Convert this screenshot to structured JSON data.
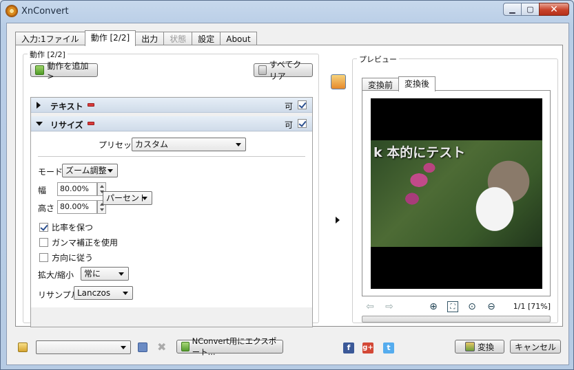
{
  "window": {
    "title": "XnConvert"
  },
  "tabs": [
    {
      "label": "入力:1ファイル",
      "state": "normal"
    },
    {
      "label": "動作 [2/2]",
      "state": "active"
    },
    {
      "label": "出力",
      "state": "normal"
    },
    {
      "label": "状態",
      "state": "disabled"
    },
    {
      "label": "設定",
      "state": "normal"
    },
    {
      "label": "About",
      "state": "normal"
    }
  ],
  "actions": {
    "group_title": "動作 [2/2]",
    "add_button": "動作を追加>",
    "clear_button": "すべてクリア",
    "operations": [
      {
        "label": "テキスト",
        "expanded": false,
        "ok_label": "可",
        "checked": true
      },
      {
        "label": "リサイズ",
        "expanded": true,
        "ok_label": "可",
        "checked": true
      }
    ],
    "resize": {
      "preset_label": "プリセット",
      "preset_value": "カスタム",
      "mode_label": "モード",
      "mode_value": "ズーム調整",
      "width_label": "幅",
      "width_value": "80.00%",
      "height_label": "高さ",
      "height_value": "80.00%",
      "unit_value": "パーセント",
      "keep_ratio_label": "比率を保つ",
      "keep_ratio_checked": true,
      "gamma_label": "ガンマ補正を使用",
      "gamma_checked": false,
      "orientation_label": "方向に従う",
      "orientation_checked": false,
      "enlarge_label": "拡大/縮小",
      "enlarge_value": "常に",
      "resample_label": "リサンプル",
      "resample_value": "Lanczos"
    }
  },
  "preview": {
    "group_title": "プレビュー",
    "tabs": [
      {
        "label": "変換前",
        "active": false
      },
      {
        "label": "変換後",
        "active": true
      }
    ],
    "overlay_text": "k 本的にテスト",
    "page_info": "1/1 [71%]",
    "progress_fraction": 0
  },
  "bottom": {
    "preset_combo_value": "",
    "export_button": "NConvert用にエクスポート...",
    "social_icons": [
      "facebook-icon",
      "google-plus-icon",
      "twitter-icon"
    ],
    "convert_button": "変換",
    "cancel_button": "キャンセル"
  }
}
